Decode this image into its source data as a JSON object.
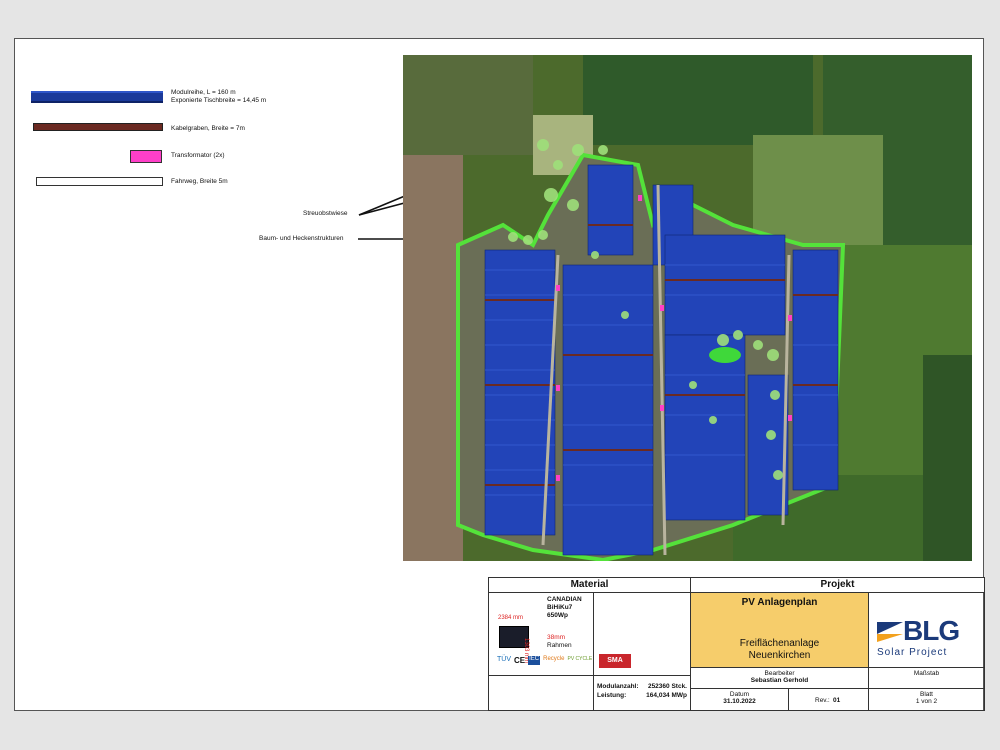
{
  "legend": {
    "module_row": {
      "line1": "Modulreihe, L = 160 m",
      "line2": "Exponierte Tischbreite = 14,45 m",
      "color": "#1b3a9a"
    },
    "cable": {
      "label": "Kabelgraben, Breite = 7m",
      "color": "#6b2a22"
    },
    "transformer": {
      "label": "Transformator (2x)",
      "color": "#ff3fc8"
    },
    "path": {
      "label": "Fahrweg, Breite 5m",
      "color": "#ffffff"
    }
  },
  "annotations": {
    "meadow": "Streuobstwiese",
    "hedges": "Baum- und Heckenstrukturen"
  },
  "titleblock": {
    "material_header": "Material",
    "projekt_header": "Projekt",
    "module_brand": "CANADIAN",
    "module_model": "BiHiKu7",
    "module_power": "650Wp",
    "dim_width": "2384 mm",
    "dim_height": "1303 mm",
    "frame_mm": "38mm",
    "frame_label": "Rahmen",
    "cert_logos": [
      "TÜV",
      "CE",
      "IEC",
      "Recycle",
      "PV CYCLE"
    ],
    "inverter_brand": "SMA",
    "modulanzahl_label": "Modulanzahl:",
    "modulanzahl_value": "252360 Stck.",
    "leistung_label": "Leistung:",
    "leistung_value": "164,034 MWp",
    "plan_title": "PV Anlagenplan",
    "plan_sub1": "Freiflächenanlage",
    "plan_sub2": "Neuenkirchen",
    "logo_big": "BLG",
    "logo_small": "Solar Project",
    "bearbeiter_label": "Bearbeiter",
    "bearbeiter_value": "Sebastian Gerhold",
    "massstab_label": "Maßstab",
    "datum_label": "Datum",
    "datum_value": "31.10.2022",
    "rev_label": "Rev.:",
    "rev_value": "01",
    "blatt_label": "Blatt",
    "blatt_value": "1 von 2",
    "plan_bg": "#f6cd6b"
  }
}
